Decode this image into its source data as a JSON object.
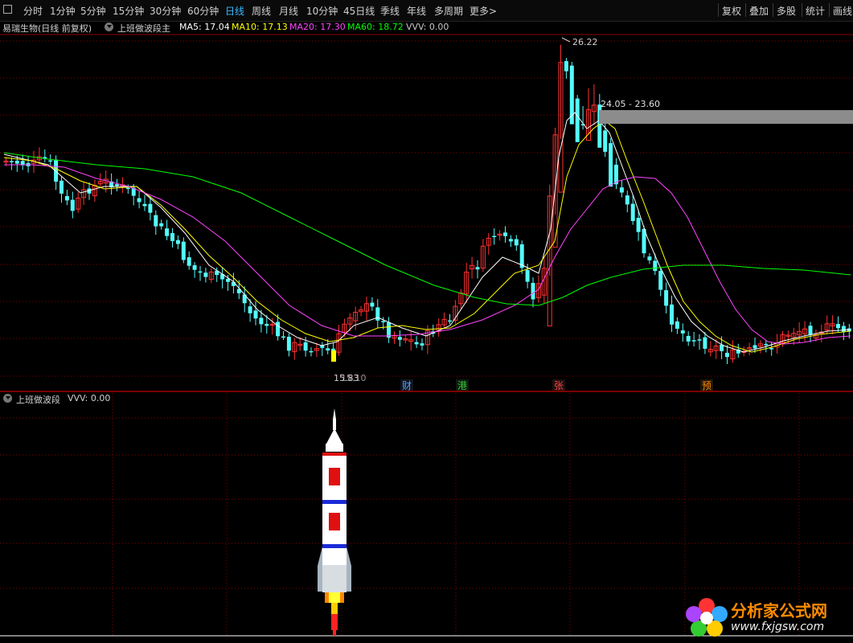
{
  "toolbar": {
    "periods": [
      {
        "label": "分时",
        "active": false
      },
      {
        "label": "1分钟",
        "active": false
      },
      {
        "label": "5分钟",
        "active": false
      },
      {
        "label": "15分钟",
        "active": false
      },
      {
        "label": "30分钟",
        "active": false
      },
      {
        "label": "60分钟",
        "active": false
      },
      {
        "label": "日线",
        "active": true
      },
      {
        "label": "周线",
        "active": false
      },
      {
        "label": "月线",
        "active": false
      },
      {
        "label": "10分钟",
        "active": false
      },
      {
        "label": "45日线",
        "active": false
      },
      {
        "label": "季线",
        "active": false
      },
      {
        "label": "年线",
        "active": false
      },
      {
        "label": "多周期",
        "active": false
      },
      {
        "label": "更多>",
        "active": false
      }
    ],
    "right_buttons": [
      "复权",
      "叠加",
      "多股",
      "统计",
      "画线"
    ]
  },
  "main_panel": {
    "stock_name": "易瑞生物(日线 前复权)",
    "indicator": "上班做波段主",
    "ma": [
      {
        "label": "MA5: 17.04",
        "color": "#ffffff"
      },
      {
        "label": "MA10: 17.13",
        "color": "#ffff00"
      },
      {
        "label": "MA20: 17.30",
        "color": "#ff44ff"
      },
      {
        "label": "MA60: 18.72",
        "color": "#00ff00"
      },
      {
        "label": "VVV: 0.00",
        "color": "#c8c8c8"
      }
    ],
    "high_label": "26.22",
    "range_label": "24.05 - 23.60",
    "low_label": "15.83",
    "low_label_overlap": "15.10",
    "event_markers": [
      {
        "label": "财",
        "color": "#4aa3ff"
      },
      {
        "label": "港",
        "color": "#33cc33"
      },
      {
        "label": "张",
        "color": "#ff4444"
      },
      {
        "label": "预",
        "color": "#ff8800"
      }
    ]
  },
  "sub_panel": {
    "indicator": "上班做波段",
    "value_label": "VVV: 0.00"
  },
  "watermark": {
    "cn": "分析家公式网",
    "url": "www.fxjgsw.com"
  },
  "colors": {
    "up": "#ff3232",
    "down": "#54fcfc",
    "ma5": "#ffffff",
    "ma10": "#ffff00",
    "ma20": "#ff44ff",
    "ma60": "#00ff00",
    "grid": "#8b0000"
  }
}
